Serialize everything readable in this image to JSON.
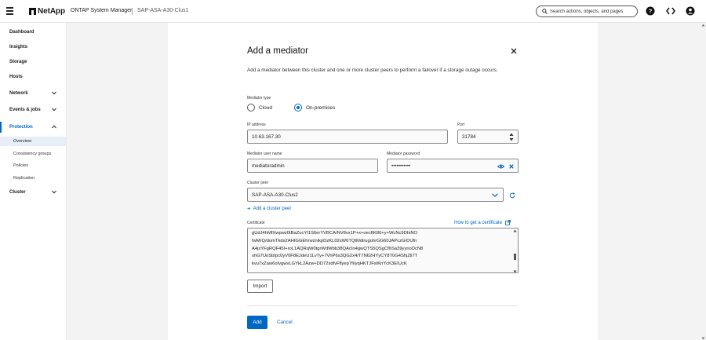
{
  "header": {
    "logo_text": "NetApp",
    "app_name": "ONTAP System Manager",
    "cluster_name": "SAP-ASA-A30-Clus1",
    "search_placeholder": "Search actions, objects, and pages",
    "icons": [
      "menu-icon",
      "search-icon",
      "help-icon",
      "code-icon",
      "user-icon"
    ]
  },
  "sidebar": {
    "items": [
      {
        "label": "Dashboard"
      },
      {
        "label": "Insights"
      },
      {
        "label": "Storage"
      },
      {
        "label": "Hosts"
      },
      {
        "label": "Network"
      },
      {
        "label": "Events & jobs"
      },
      {
        "label": "Protection"
      },
      {
        "label": "Cluster"
      }
    ],
    "protection_sub": [
      {
        "label": "Overview"
      },
      {
        "label": "Consistency groups"
      },
      {
        "label": "Policies"
      },
      {
        "label": "Replication"
      }
    ]
  },
  "modal": {
    "title": "Add a mediator",
    "description": "Add a mediator between this cluster and one or more cluster peers to perform a failover if a storage outage occurs.",
    "mediator_type_label": "Mediator type",
    "option_cloud": "Cloud",
    "option_onprem": "On-premises",
    "selected_type": "On-premises",
    "ip_label": "IP address",
    "ip_value": "10.63.167.30",
    "port_label": "Port",
    "port_value": "31784",
    "user_label": "Mediator user name",
    "user_value": "mediatoradmin",
    "password_label": "Mediator password",
    "password_value": "•••••••••••",
    "peer_label": "Cluster peer",
    "peer_value": "SAP-ASA-A30-Clus2",
    "add_peer_link": "Add a cluster peer",
    "cert_label": "Certificate",
    "cert_help_link": "How to get a certificate",
    "cert_lines": [
      "gUdJ4hMfXwpwz0tBaZucYI1S6erYVBCA/NV8vx1P+x+oecftK86+y+WcNc9DfsNO",
      "fwMrQ/domTkds2AHIGGEhrwznikpDzKL02sW6TQtMdirugohrGG60JAPczG/DUfn",
      "A4jxYFgRQF45I+roL1AQRqW0tgrWdWbb38QAcIn4gwQTS5QSgCf6Sa39yynoDcN8",
      "xhG7UoSbIpc0yV0F8EJdeU1LvTy+7VhP6s3QG2x4/T7N62HYyCY8T0G4ShjZli7T",
      "kvu7xZaw6oIvgwvLGYkL2Azw+DD72xdfvFflyep7fi/yqHKTJFsIKnYcK3EIUcK"
    ],
    "import_label": "Import",
    "add_label": "Add",
    "cancel_label": "Cancel"
  }
}
